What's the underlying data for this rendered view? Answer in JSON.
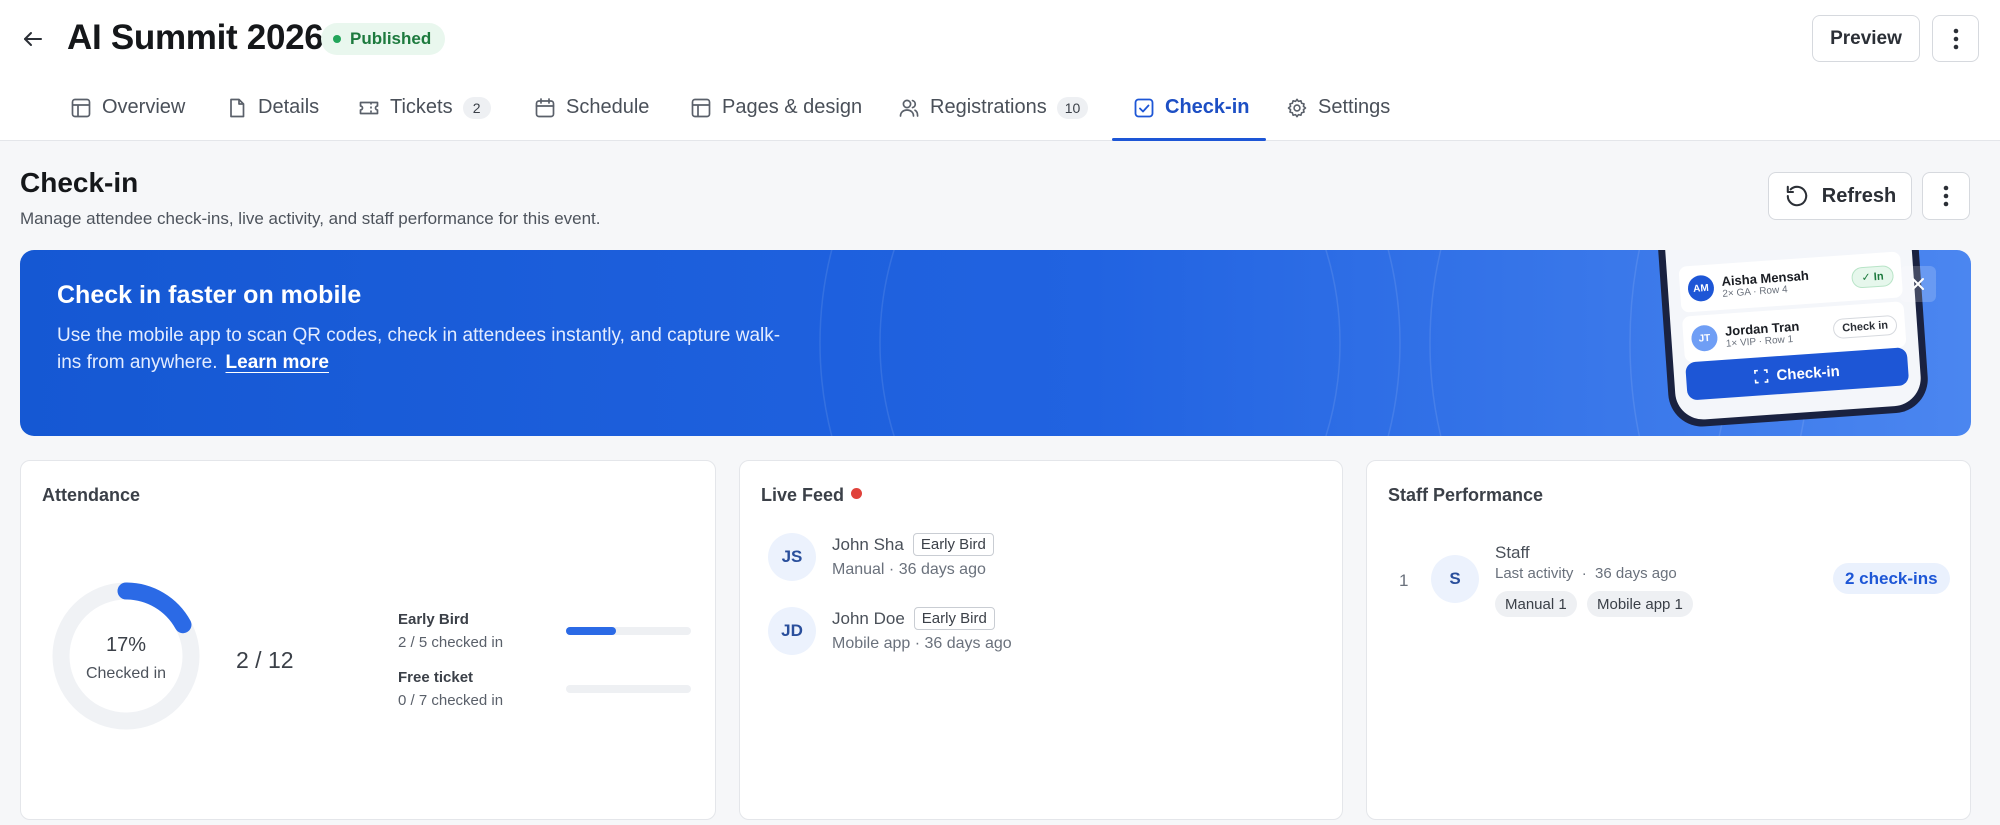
{
  "header": {
    "title": "AI Summit 2026",
    "status": "Published",
    "preview_label": "Preview"
  },
  "tabs": [
    {
      "label": "Overview",
      "icon": "layout-icon"
    },
    {
      "label": "Details",
      "icon": "document-icon"
    },
    {
      "label": "Tickets",
      "icon": "ticket-icon",
      "count": "2"
    },
    {
      "label": "Schedule",
      "icon": "calendar-icon"
    },
    {
      "label": "Pages & design",
      "icon": "layout-icon"
    },
    {
      "label": "Registrations",
      "icon": "users-icon",
      "count": "10"
    },
    {
      "label": "Check-in",
      "icon": "checkbox-icon",
      "active": true
    },
    {
      "label": "Settings",
      "icon": "gear-icon"
    }
  ],
  "section": {
    "title": "Check-in",
    "subtitle": "Manage attendee check-ins, live activity, and staff performance for this event.",
    "refresh_label": "Refresh"
  },
  "banner": {
    "title": "Check in faster on mobile",
    "text": "Use the mobile app to scan QR codes, check in attendees instantly, and capture walk-ins from anywhere.",
    "link": "Learn more",
    "phone": {
      "rows": [
        {
          "initials": "AM",
          "name": "Aisha Mensah",
          "meta": "2× GA · Row 4",
          "action": "In"
        },
        {
          "initials": "JT",
          "name": "Jordan Tran",
          "meta": "1× VIP · Row 1",
          "action": "Check in"
        }
      ],
      "cta": "Check-in"
    }
  },
  "attendance": {
    "title": "Attendance",
    "percent": "17%",
    "percent_value": 0.17,
    "label": "Checked in",
    "total": "2 / 12",
    "tiers": [
      {
        "name": "Early Bird",
        "sub": "2 / 5 checked in",
        "fill": 0.4
      },
      {
        "name": "Free ticket",
        "sub": "0 / 7 checked in",
        "fill": 0
      }
    ]
  },
  "live_feed": {
    "title": "Live Feed",
    "items": [
      {
        "initials": "JS",
        "name": "John Sha",
        "tag": "Early Bird",
        "meta": "Manual · 36 days ago"
      },
      {
        "initials": "JD",
        "name": "John Doe",
        "tag": "Early Bird",
        "meta": "Mobile app · 36 days ago"
      }
    ]
  },
  "staff": {
    "title": "Staff Performance",
    "rank": "1",
    "initials": "S",
    "name": "Staff",
    "activity": "Last activity  ·  36 days ago",
    "chips": [
      "Manual 1",
      "Mobile app 1"
    ],
    "checkins": "2 check-ins"
  },
  "colors": {
    "accent": "#1d56d6",
    "published": "#22a55a",
    "live_dot": "#e0423b"
  }
}
